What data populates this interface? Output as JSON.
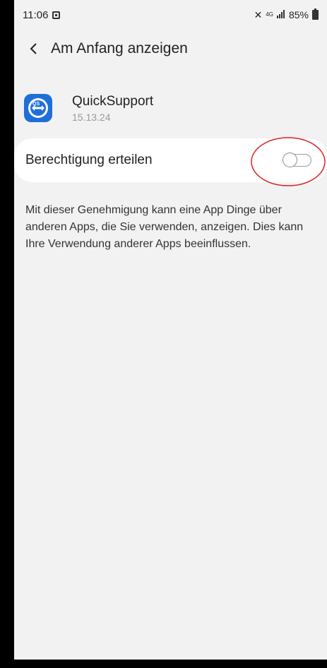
{
  "status_bar": {
    "time": "11:06",
    "network": "4G",
    "battery": "85%"
  },
  "toolbar": {
    "back_glyph": "<",
    "title": "Am Anfang anzeigen"
  },
  "app": {
    "name": "QuickSupport",
    "version": "15.13.24",
    "icon": "teamviewer-quicksupport-icon",
    "icon_color": "#1e6fd9"
  },
  "permission": {
    "label": "Berechtigung erteilen",
    "enabled": false,
    "highlight_color": "#e02020"
  },
  "description": "Mit dieser Genehmigung kann eine App Dinge über anderen Apps, die Sie verwenden, anzeigen. Dies kann Ihre Verwendung anderer Apps beeinflussen."
}
